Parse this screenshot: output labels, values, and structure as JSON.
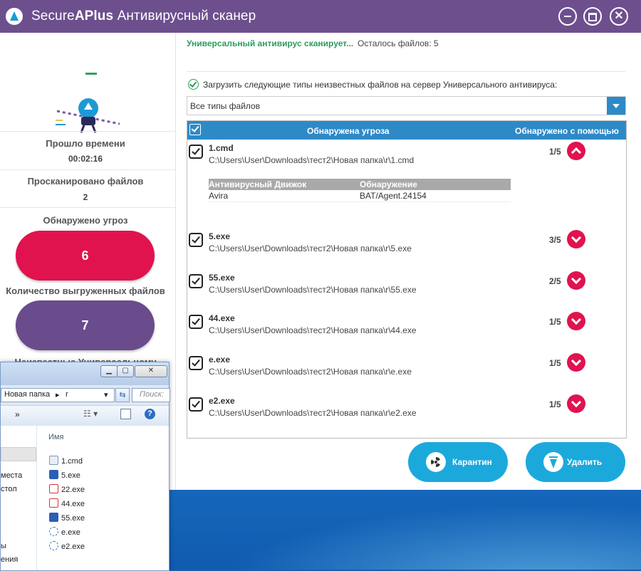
{
  "window": {
    "title_brand_plain": "Secure",
    "title_brand_bold": "APlus",
    "title_rest": "Антивирусный сканер",
    "close_symbol": "✕"
  },
  "sidebar": {
    "elapsed_label": "Прошло времени",
    "elapsed_value": "00:02:16",
    "scanned_label": "Просканировано файлов",
    "scanned_value": "2",
    "threats_label": "Обнаружено угроз",
    "threats_value": "6",
    "uploaded_label": "Количество выгруженных файлов",
    "uploaded_value": "7",
    "unknown_label": "Неизвестные Универсальному"
  },
  "status": {
    "scanning_text": "Универсальный антивирус сканирует...",
    "remaining_text": "Осталось файлов: 5"
  },
  "upload_option": {
    "label": "Загрузить следующие типы неизвестных файлов на сервер Универсального антивируса:",
    "checked": true,
    "selected_value": "Все типы файлов"
  },
  "table": {
    "col_threat": "Обнаружена угроза",
    "col_detected_by": "Обнаружено с помощью",
    "detail_col_engine": "Антивирусный Движок",
    "detail_col_detection": "Обнаружение",
    "rows": [
      {
        "name": "1.cmd",
        "path": "C:\\Users\\User\\Downloads\\тест2\\Новая папка\\r\\1.cmd",
        "ratio": "1/5",
        "expanded": true,
        "details": [
          {
            "engine": "Avira",
            "detection": "BAT/Agent.24154"
          }
        ]
      },
      {
        "name": "5.exe",
        "path": "C:\\Users\\User\\Downloads\\тест2\\Новая папка\\r\\5.exe",
        "ratio": "3/5",
        "expanded": false
      },
      {
        "name": "55.exe",
        "path": "C:\\Users\\User\\Downloads\\тест2\\Новая папка\\r\\55.exe",
        "ratio": "2/5",
        "expanded": false
      },
      {
        "name": "44.exe",
        "path": "C:\\Users\\User\\Downloads\\тест2\\Новая папка\\r\\44.exe",
        "ratio": "1/5",
        "expanded": false
      },
      {
        "name": "e.exe",
        "path": "C:\\Users\\User\\Downloads\\тест2\\Новая папка\\r\\e.exe",
        "ratio": "1/5",
        "expanded": false
      },
      {
        "name": "e2.exe",
        "path": "C:\\Users\\User\\Downloads\\тест2\\Новая папка\\r\\e2.exe",
        "ratio": "1/5",
        "expanded": false
      }
    ]
  },
  "actions": {
    "quarantine_label": "Карантин",
    "delete_label": "Удалить"
  },
  "explorer": {
    "address_part1": "Новая папка",
    "address_sep": "▸",
    "address_part2": "r",
    "search_placeholder": "Поиск:",
    "toolbar_more": "»",
    "column_name": "Имя",
    "nav_items": [
      "места",
      "стол",
      "ы",
      "ения"
    ],
    "files": [
      {
        "name": "1.cmd",
        "icon": "cmd-file-icon"
      },
      {
        "name": "5.exe",
        "icon": "word-file-icon"
      },
      {
        "name": "22.exe",
        "icon": "pdf-file-icon"
      },
      {
        "name": "44.exe",
        "icon": "pdf-file-icon"
      },
      {
        "name": "55.exe",
        "icon": "word-file-icon"
      },
      {
        "name": "e.exe",
        "icon": "exe-file-icon"
      },
      {
        "name": "e2.exe",
        "icon": "exe-file-icon"
      }
    ]
  },
  "colors": {
    "titlebar": "#6d4f8e",
    "threat_red": "#e0134f",
    "uploaded_purple": "#6a4b8c",
    "accent_blue": "#2d8ac7",
    "action_button": "#1ba9dc",
    "scan_green": "#2f9a5c"
  }
}
